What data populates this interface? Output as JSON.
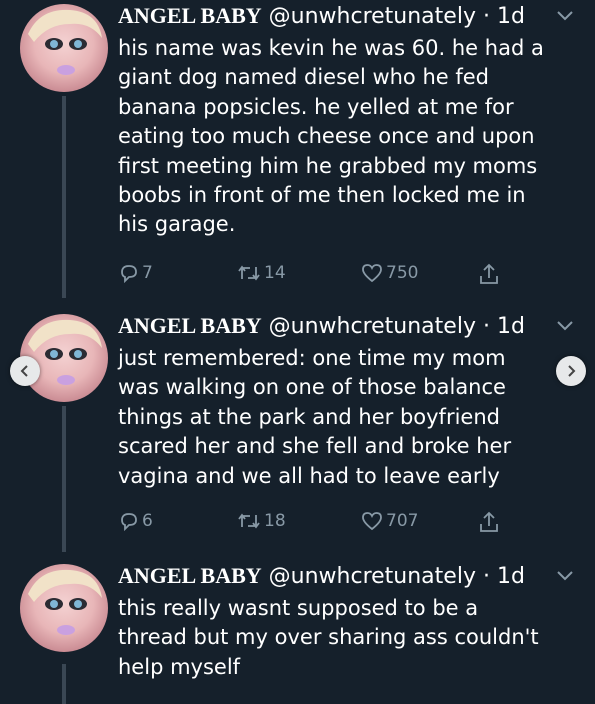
{
  "tweets": [
    {
      "name": "ANGEL BABY",
      "handle": "@unwhcretunately",
      "dot": "·",
      "time": "1d",
      "lines": [
        "his name was kevin he was 60. he had a",
        "giant dog named diesel who he fed",
        "banana popsicles. he yelled at me for",
        "eating too much cheese once and upon",
        "first meeting him he grabbed my moms",
        "boobs in front of me then locked me in",
        "his garage."
      ],
      "replies": "7",
      "retweets": "14",
      "likes": "750"
    },
    {
      "name": "ANGEL BABY",
      "handle": "@unwhcretunately",
      "dot": "·",
      "time": "1d",
      "lines": [
        "just remembered: one time my mom",
        "was walking on one of those balance",
        "things at the park and her boyfriend",
        "scared her and she fell and broke her",
        "vagina and we all had to leave early"
      ],
      "replies": "6",
      "retweets": "18",
      "likes": "707"
    },
    {
      "name": "ANGEL BABY",
      "handle": "@unwhcretunately",
      "dot": "·",
      "time": "1d",
      "lines": [
        "this really wasnt supposed to be a",
        "thread but my over sharing ass couldn't",
        "help myself"
      ]
    }
  ],
  "icons": {
    "reply": "reply-icon",
    "retweet": "retweet-icon",
    "like": "heart-icon",
    "share": "share-icon",
    "menu": "chevron-down-icon",
    "prev": "chevron-left-icon",
    "next": "chevron-right-icon"
  },
  "colors": {
    "background": "#15202b",
    "text": "#ffffff",
    "muted": "#8899a6",
    "thread_line": "#3a4754"
  }
}
